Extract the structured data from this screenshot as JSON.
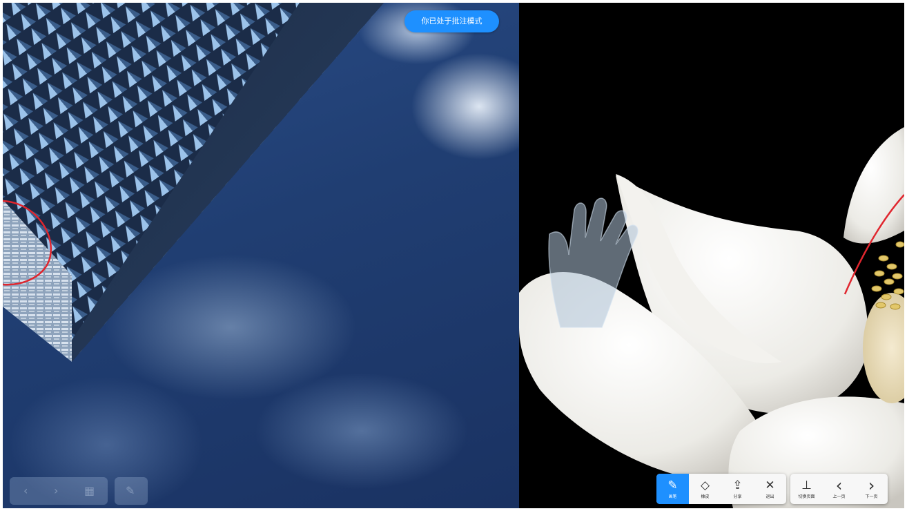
{
  "banner": {
    "text": "你已处于批注模式"
  },
  "toolbar": {
    "tools": [
      {
        "label": "画笔",
        "icon": "pen-icon",
        "glyph": "✎"
      },
      {
        "label": "橡皮",
        "icon": "eraser-icon",
        "glyph": "◇"
      },
      {
        "label": "分享",
        "icon": "share-icon",
        "glyph": "⇪"
      },
      {
        "label": "退出",
        "icon": "close-icon",
        "glyph": "✕"
      }
    ],
    "nav": [
      {
        "label": "切换页面",
        "icon": "presentation-icon",
        "glyph": "⊥"
      },
      {
        "label": "上一页",
        "icon": "chevron-left-icon",
        "glyph": "‹"
      },
      {
        "label": "下一页",
        "icon": "chevron-right-icon",
        "glyph": "›"
      }
    ]
  },
  "colors": {
    "accent": "#1e90ff",
    "annotation": "#e0262e",
    "sky": "#203e72",
    "background_right": "#000000"
  }
}
